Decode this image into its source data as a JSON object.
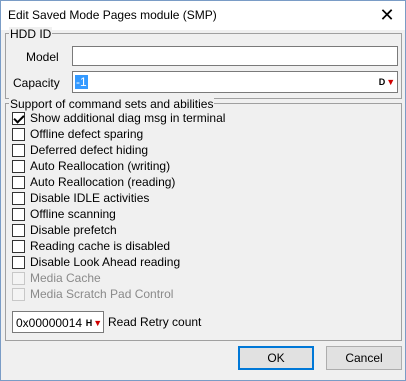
{
  "window": {
    "title": "Edit Saved Mode Pages module (SMP)",
    "close_glyph": "✕"
  },
  "hdd_id": {
    "legend": "HDD ID",
    "model_label": "Model",
    "model_value": "",
    "capacity_label": "Capacity",
    "capacity_value": "-1",
    "capacity_spin": {
      "prefix": "D",
      "icon": "red-down-arrow"
    }
  },
  "support": {
    "legend": "Support of command sets and abilities",
    "options": [
      {
        "label": "Show additional diag msg in terminal",
        "checked": true,
        "enabled": true
      },
      {
        "label": "Offline defect sparing",
        "checked": false,
        "enabled": true
      },
      {
        "label": "Deferred defect hiding",
        "checked": false,
        "enabled": true
      },
      {
        "label": "Auto Reallocation (writing)",
        "checked": false,
        "enabled": true
      },
      {
        "label": "Auto Reallocation (reading)",
        "checked": false,
        "enabled": true
      },
      {
        "label": "Disable IDLE activities",
        "checked": false,
        "enabled": true
      },
      {
        "label": "Offline scanning",
        "checked": false,
        "enabled": true
      },
      {
        "label": "Disable prefetch",
        "checked": false,
        "enabled": true
      },
      {
        "label": "Reading cache is disabled",
        "checked": false,
        "enabled": true
      },
      {
        "label": "Disable Look Ahead reading",
        "checked": false,
        "enabled": true
      },
      {
        "label": "Media Cache",
        "checked": false,
        "enabled": false
      },
      {
        "label": "Media Scratch Pad Control",
        "checked": false,
        "enabled": false
      }
    ],
    "retry_value": "0x00000014",
    "retry_spin": {
      "prefix": "H",
      "icon": "red-down-arrow"
    },
    "retry_label": "Read Retry count"
  },
  "buttons": {
    "ok": "OK",
    "cancel": "Cancel"
  },
  "colors": {
    "selection": "#3399ff",
    "default_button_border": "#0078d7",
    "spin_arrow": "#d00000"
  }
}
